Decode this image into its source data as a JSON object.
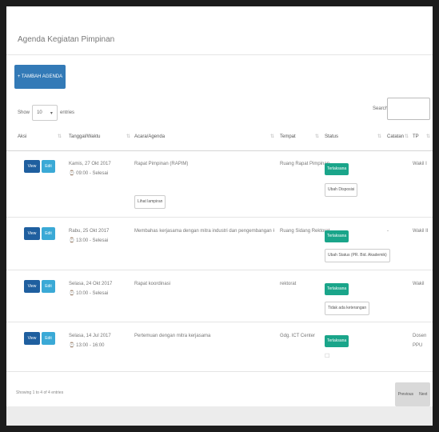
{
  "panel_title": "Agenda Kegiatan Pimpinan",
  "add_button": "+ TAMBAH AGENDA",
  "show": {
    "prefix": "Show",
    "value": "10",
    "suffix": "entries"
  },
  "search_label": "Search:",
  "columns": [
    "Aksi",
    "Tanggal/Waktu",
    "Acara/Agenda",
    "Tempat",
    "Status",
    "Catatan",
    "TP"
  ],
  "actions": {
    "view": "View",
    "edit": "Edit"
  },
  "rows": [
    {
      "date": "Kamis, 27 Okt 2017",
      "time": "⌚ 09:00 - Selesai",
      "agenda": "Rapat Pimpinan (RAPIM)",
      "extra_button": "Lihat lampiran",
      "place": "Ruang Rapat Pimpinan",
      "status": "Terlaksana",
      "status_button": "Ubah Disposisi",
      "note": "",
      "tp": "Wakil I"
    },
    {
      "date": "Rabu, 25 Okt 2017",
      "time": "⌚ 13:00 - Selesai",
      "agenda": "Membahas kerjasama dengan mitra industri dan pengembangan kampus",
      "extra_button": "",
      "place": "Ruang Sidang Rektorat",
      "status": "Terlaksana",
      "status_button": "Ubah Status (PR. Bid. Akademik)",
      "note": "-",
      "tp": "Wakil II"
    },
    {
      "date": "Selasa, 24 Okt 2017",
      "time": "⌚ 10:00 - Selesai",
      "agenda": "Rapat koordinasi",
      "extra_button": "",
      "place": "rektorat",
      "status": "Terlaksana",
      "status_button": "Tidak ada keterangan",
      "note": "",
      "tp": "Wakil"
    },
    {
      "date": "Selasa, 14 Jul 2017",
      "time": "⌚ 13:00 - 16:00",
      "agenda": "Pertemuan dengan mitra kerjasama",
      "extra_button": "",
      "place": "Gdg. ICT Center",
      "status": "Terlaksana",
      "status_button": "",
      "note": "",
      "tp": "Dosen PPU"
    }
  ],
  "footer_info": "Showing 1 to 4 of 4 entries",
  "pager": {
    "previous": "Previous",
    "next": "Next"
  }
}
